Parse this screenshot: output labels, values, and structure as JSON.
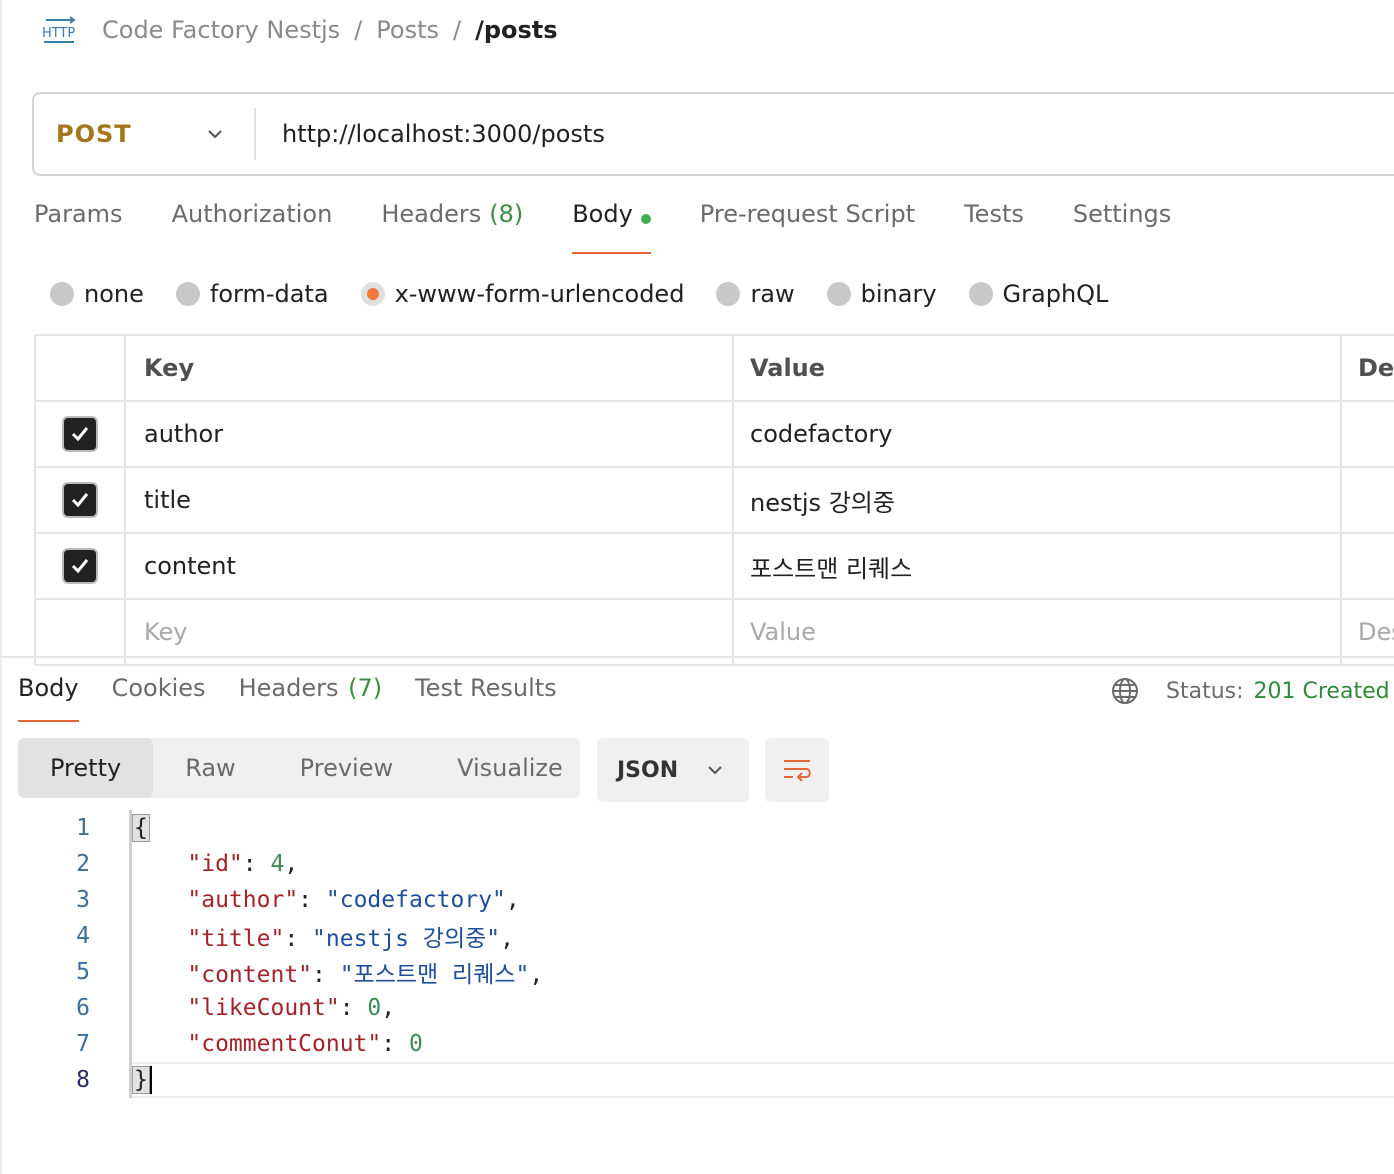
{
  "breadcrumb": {
    "icon": "http-icon",
    "collection": "Code Factory Nestjs",
    "folder": "Posts",
    "request": "/posts",
    "separator": "/"
  },
  "request": {
    "method": "POST",
    "url": "http://localhost:3000/posts"
  },
  "request_tabs": [
    {
      "label": "Params"
    },
    {
      "label": "Authorization"
    },
    {
      "label": "Headers",
      "count": "(8)"
    },
    {
      "label": "Body",
      "active": true
    },
    {
      "label": "Pre-request Script"
    },
    {
      "label": "Tests"
    },
    {
      "label": "Settings"
    }
  ],
  "body_types": [
    {
      "label": "none"
    },
    {
      "label": "form-data"
    },
    {
      "label": "x-www-form-urlencoded",
      "selected": true
    },
    {
      "label": "raw"
    },
    {
      "label": "binary"
    },
    {
      "label": "GraphQL"
    }
  ],
  "params_table": {
    "headers": [
      "Key",
      "Value",
      "Des"
    ],
    "rows": [
      {
        "checked": true,
        "key": "author",
        "value": "codefactory"
      },
      {
        "checked": true,
        "key": "title",
        "value": "nestjs 강의중"
      },
      {
        "checked": true,
        "key": "content",
        "value": "포스트맨 리퀘스"
      }
    ],
    "placeholder": {
      "key": "Key",
      "value": "Value",
      "desc": "Des"
    }
  },
  "response_tabs": [
    {
      "label": "Body",
      "active": true
    },
    {
      "label": "Cookies"
    },
    {
      "label": "Headers",
      "count": "(7)"
    },
    {
      "label": "Test Results"
    }
  ],
  "status": {
    "label": "Status:",
    "value": "201 Created"
  },
  "view_modes": [
    {
      "label": "Pretty",
      "active": true
    },
    {
      "label": "Raw"
    },
    {
      "label": "Preview"
    },
    {
      "label": "Visualize"
    }
  ],
  "format": "JSON",
  "code_lines": [
    "1",
    "2",
    "3",
    "4",
    "5",
    "6",
    "7",
    "8"
  ],
  "response_json": {
    "open": "{",
    "close": "}",
    "id_key": "\"id\"",
    "id_val": "4",
    "author_key": "\"author\"",
    "author_val": "\"codefactory\"",
    "title_key": "\"title\"",
    "title_val": "\"nestjs 강의중\"",
    "content_key": "\"content\"",
    "content_val": "\"포스트맨 리퀘스\"",
    "likeCount_key": "\"likeCount\"",
    "likeCount_val": "0",
    "commentConut_key": "\"commentConut\"",
    "commentConut_val": "0"
  },
  "colors": {
    "accent": "#e8653a",
    "method": "#a6761d",
    "success": "#2f8a3a",
    "json_key": "#a3232b",
    "json_string": "#1f4e9a",
    "json_number": "#3e8a57"
  }
}
